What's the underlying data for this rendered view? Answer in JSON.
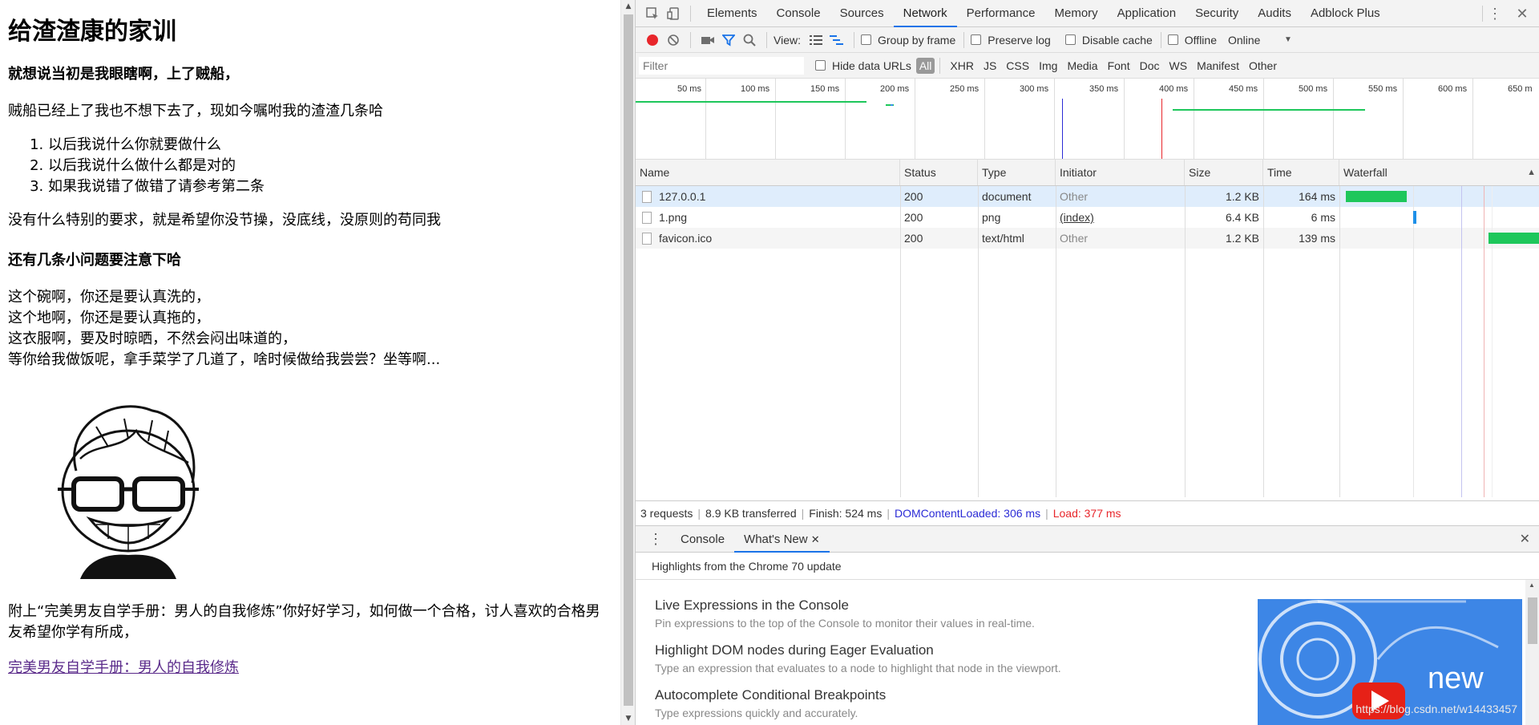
{
  "page": {
    "title": "给渣渣康的家训",
    "bold_line": "就想说当初是我眼瞎啊，上了贼船，",
    "intro": "贼船已经上了我也不想下去了，现如今嘱咐我的渣渣几条哈",
    "rules": [
      "以后我说什么你就要做什么",
      "以后我说什么做什么都是对的",
      "如果我说错了做错了请参考第二条"
    ],
    "no_req": "没有什么特别的要求，就是希望你没节操，没底线，没原则的苟同我",
    "small_issues": "还有几条小问题要注意下哈",
    "lines": [
      "这个碗啊，你还是要认真洗的，",
      "这个地啊，你还是要认真拖的，",
      "这衣服啊，要及时晾晒，不然会闷出味道的，",
      "等你给我做饭呢，拿手菜学了几道了，啥时候做给我尝尝？坐等啊..."
    ],
    "appendix": "附上“完美男友自学手册：男人的自我修炼”你好好学习，如何做一个合格，讨人喜欢的合格男友希望你学有所成，",
    "link": "完美男友自学手册：男人的自我修炼"
  },
  "devtools": {
    "tabs": [
      "Elements",
      "Console",
      "Sources",
      "Network",
      "Performance",
      "Memory",
      "Application",
      "Security",
      "Audits",
      "Adblock Plus"
    ],
    "active_tab": "Network",
    "toolbar": {
      "view_label": "View:",
      "group_by_frame": "Group by frame",
      "preserve_log": "Preserve log",
      "disable_cache": "Disable cache",
      "offline": "Offline",
      "throttle": "Online"
    },
    "filter": {
      "placeholder": "Filter",
      "hide_data_urls": "Hide data URLs",
      "types": [
        "All",
        "XHR",
        "JS",
        "CSS",
        "Img",
        "Media",
        "Font",
        "Doc",
        "WS",
        "Manifest",
        "Other"
      ]
    },
    "overview_ticks": [
      "50 ms",
      "100 ms",
      "150 ms",
      "200 ms",
      "250 ms",
      "300 ms",
      "350 ms",
      "400 ms",
      "450 ms",
      "500 ms",
      "550 ms",
      "600 ms",
      "650 m"
    ],
    "columns": [
      "Name",
      "Status",
      "Type",
      "Initiator",
      "Size",
      "Time",
      "Waterfall"
    ],
    "rows": [
      {
        "name": "127.0.0.1",
        "status": "200",
        "type": "document",
        "initiator": "Other",
        "size": "1.2 KB",
        "time": "164 ms"
      },
      {
        "name": "1.png",
        "status": "200",
        "type": "png",
        "initiator": "(index)",
        "size": "6.4 KB",
        "time": "6 ms"
      },
      {
        "name": "favicon.ico",
        "status": "200",
        "type": "text/html",
        "initiator": "Other",
        "size": "1.2 KB",
        "time": "139 ms"
      }
    ],
    "summary": {
      "requests": "3 requests",
      "transferred": "8.9 KB transferred",
      "finish": "Finish: 524 ms",
      "dcl": "DOMContentLoaded: 306 ms",
      "load": "Load: 377 ms"
    },
    "drawer": {
      "tabs": [
        "Console",
        "What's New"
      ],
      "subtitle": "Highlights from the Chrome 70 update",
      "items": [
        {
          "title": "Live Expressions in the Console",
          "desc": "Pin expressions to the top of the Console to monitor their values in real-time."
        },
        {
          "title": "Highlight DOM nodes during Eager Evaluation",
          "desc": "Type an expression that evaluates to a node to highlight that node in the viewport."
        },
        {
          "title": "Autocomplete Conditional Breakpoints",
          "desc": "Type expressions quickly and accurately."
        }
      ],
      "promo_text": "new",
      "watermark": "https://blog.csdn.net/w14433457"
    },
    "colors": {
      "accent": "#1a73e8",
      "record": "#e8262b",
      "bar_green": "#1ec75b",
      "dcl_blue": "#2b2bd6",
      "load_red": "#e8262b"
    }
  }
}
